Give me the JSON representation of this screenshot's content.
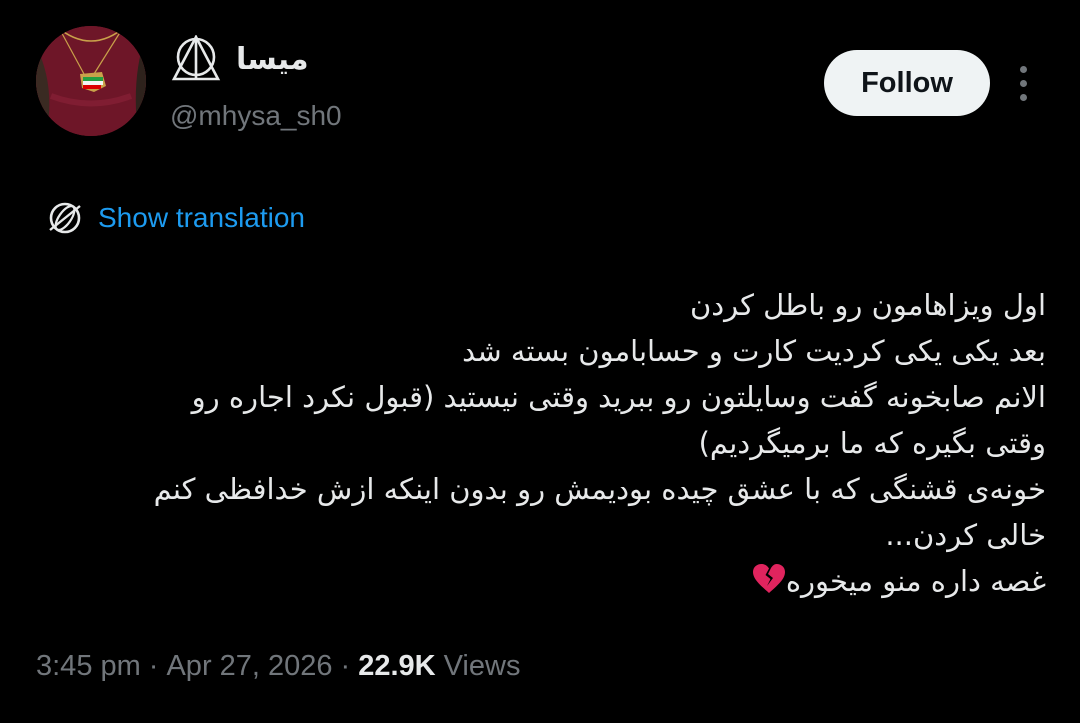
{
  "user": {
    "display_name": "میسا",
    "handle": "@mhysa_sh0"
  },
  "actions": {
    "follow_label": "Follow",
    "more_icon": "more-vertical-icon"
  },
  "translation": {
    "label": "Show translation",
    "icon": "globe-icon"
  },
  "tweet": {
    "lines": [
      "اول ویزاهامون رو باطل کردن",
      "بعد یکی یکی کردیت کارت و حسابامون بسته شد",
      "الانم صابخونه گفت وسایلتون رو ببرید وقتی نیستید (قبول نکرد اجاره رو",
      "وقتی بگیره که ما برمیگردیم)",
      "خونه‌ی قشنگی که با عشق چیده بودیمش رو بدون اینکه ازش خدافظی کنم",
      "خالی کردن...",
      "غصه داره منو میخوره"
    ],
    "emoji": "broken-heart-icon"
  },
  "meta": {
    "time": "3:45 pm",
    "date": "Apr 27, 2026",
    "views_count": "22.9K",
    "views_label": "Views",
    "separator": "·"
  },
  "colors": {
    "background": "#000000",
    "text_primary": "#e7e9ea",
    "text_secondary": "#71767b",
    "link": "#1d9bf0",
    "button_bg": "#eff3f4"
  }
}
